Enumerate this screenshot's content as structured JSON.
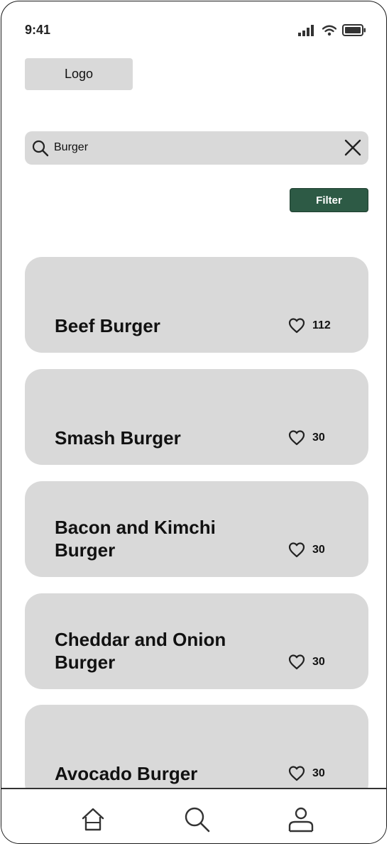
{
  "status_bar": {
    "time": "9:41",
    "icons": [
      "cellular-signal-icon",
      "wifi-icon",
      "battery-icon"
    ]
  },
  "header": {
    "logo_label": "Logo"
  },
  "search": {
    "icon": "search-icon",
    "value": "Burger",
    "placeholder": "",
    "clear_icon": "close-icon"
  },
  "filter": {
    "label": "Filter",
    "color": "#2d5a45"
  },
  "results": [
    {
      "title": "Beef Burger",
      "likes": "112"
    },
    {
      "title": "Smash Burger",
      "likes": "30"
    },
    {
      "title": "Bacon and Kimchi Burger",
      "likes": "30"
    },
    {
      "title": "Cheddar and Onion Burger",
      "likes": "30"
    },
    {
      "title": "Avocado Burger",
      "likes": "30"
    }
  ],
  "tab_bar": {
    "tabs": [
      {
        "icon": "home-icon"
      },
      {
        "icon": "search-icon"
      },
      {
        "icon": "profile-icon"
      }
    ]
  },
  "colors": {
    "card_bg": "#d9d9d9",
    "filter_bg": "#2d5a45"
  }
}
